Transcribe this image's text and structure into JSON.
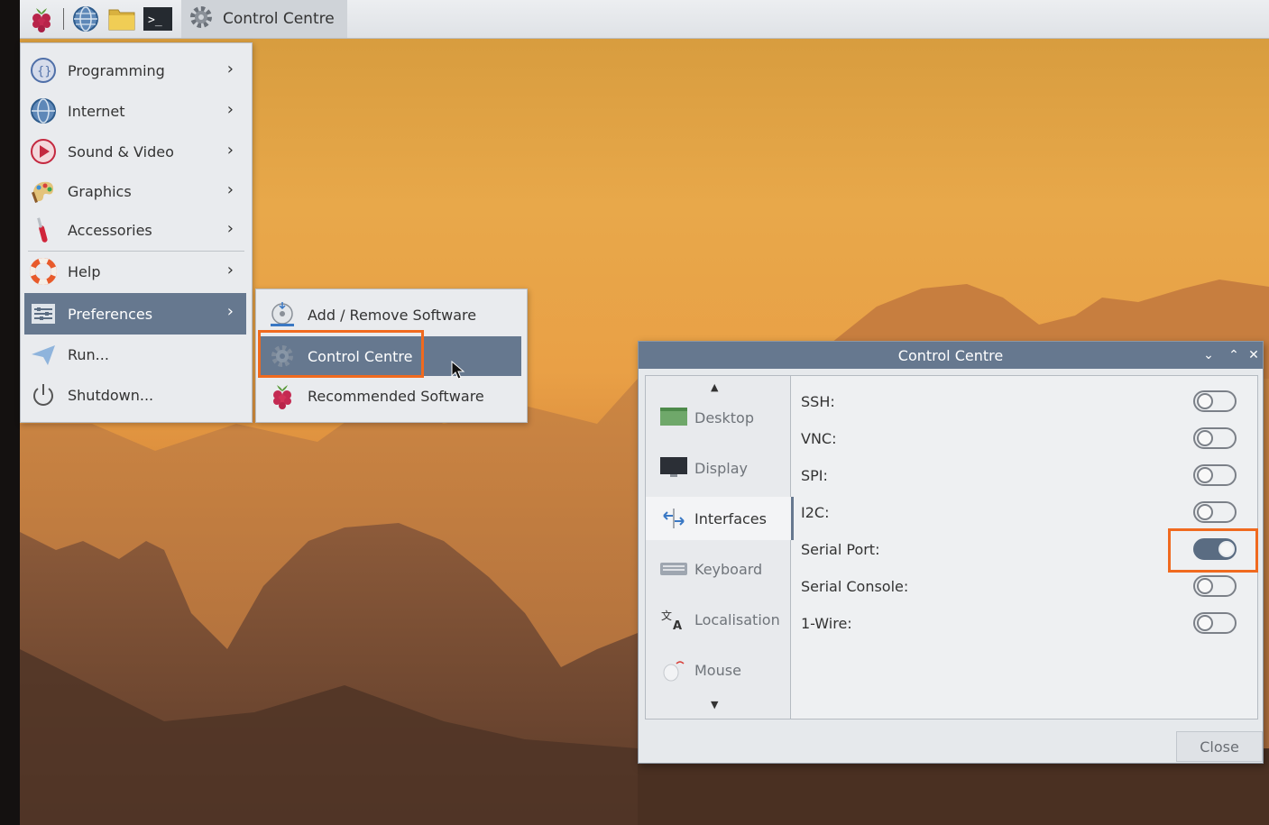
{
  "taskbar": {
    "icons": [
      "raspberry-menu-icon",
      "web-browser-icon",
      "file-manager-icon",
      "terminal-icon"
    ],
    "window_title": "Control Centre"
  },
  "main_menu": {
    "items": [
      {
        "label": "Programming",
        "icon": "programming-icon",
        "has_submenu": true
      },
      {
        "label": "Internet",
        "icon": "globe-icon",
        "has_submenu": true
      },
      {
        "label": "Sound & Video",
        "icon": "play-icon",
        "has_submenu": true
      },
      {
        "label": "Graphics",
        "icon": "palette-icon",
        "has_submenu": true
      },
      {
        "label": "Accessories",
        "icon": "knife-icon",
        "has_submenu": true
      },
      {
        "label": "Help",
        "icon": "lifebuoy-icon",
        "has_submenu": true
      },
      {
        "label": "Preferences",
        "icon": "preferences-icon",
        "has_submenu": true,
        "active": true
      },
      {
        "label": "Run...",
        "icon": "paper-plane-icon",
        "has_submenu": false
      },
      {
        "label": "Shutdown...",
        "icon": "power-icon",
        "has_submenu": false
      }
    ]
  },
  "submenu": {
    "items": [
      {
        "label": "Add / Remove Software",
        "icon": "software-install-icon"
      },
      {
        "label": "Control Centre",
        "icon": "gear-icon",
        "active": true
      },
      {
        "label": "Recommended Software",
        "icon": "raspberry-icon"
      }
    ]
  },
  "control_centre": {
    "title": "Control Centre",
    "sidebar": [
      {
        "label": "Desktop",
        "icon": "desktop-icon"
      },
      {
        "label": "Display",
        "icon": "monitor-icon"
      },
      {
        "label": "Interfaces",
        "icon": "interfaces-icon",
        "active": true
      },
      {
        "label": "Keyboard",
        "icon": "keyboard-icon"
      },
      {
        "label": "Localisation",
        "icon": "localisation-icon"
      },
      {
        "label": "Mouse",
        "icon": "mouse-icon"
      }
    ],
    "interfaces": [
      {
        "label": "SSH:",
        "enabled": false
      },
      {
        "label": "VNC:",
        "enabled": false
      },
      {
        "label": "SPI:",
        "enabled": false
      },
      {
        "label": "I2C:",
        "enabled": false
      },
      {
        "label": "Serial Port:",
        "enabled": true
      },
      {
        "label": "Serial Console:",
        "enabled": false
      },
      {
        "label": "1-Wire:",
        "enabled": false
      }
    ],
    "close_label": "Close"
  },
  "colors": {
    "accent": "#66788f",
    "highlight": "#f06a1f",
    "menu_bg": "#e9ebee"
  }
}
